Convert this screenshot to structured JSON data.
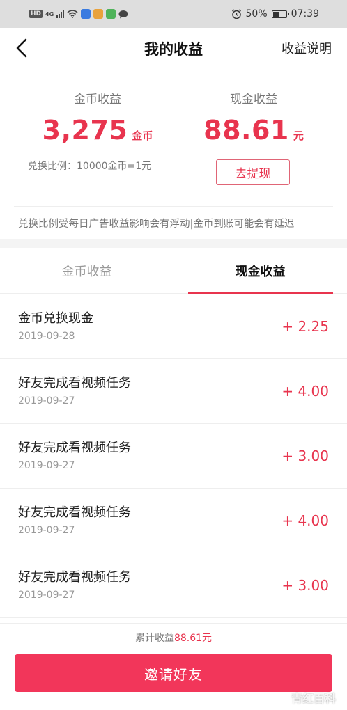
{
  "status_bar": {
    "network": "HD",
    "signal_label": "4G",
    "battery_percent": "50%",
    "time": "07:39",
    "battery_level": 0.5
  },
  "nav": {
    "title": "我的收益",
    "right_link": "收益说明"
  },
  "summary": {
    "coin_label": "金币收益",
    "coin_amount": "3,275",
    "coin_unit": "金币",
    "cash_label": "现金收益",
    "cash_amount": "88.61",
    "cash_unit": "元",
    "ratio_text": "兑换比例：10000金币=1元",
    "withdraw_label": "去提现",
    "notice": "兑换比例受每日广告收益影响会有浮动|金币到账可能会有延迟"
  },
  "tabs": [
    {
      "label": "金币收益",
      "active": false
    },
    {
      "label": "现金收益",
      "active": true
    }
  ],
  "records": [
    {
      "title": "金币兑换现金",
      "date": "2019-09-28",
      "amount": "+ 2.25"
    },
    {
      "title": "好友完成看视频任务",
      "date": "2019-09-27",
      "amount": "+ 4.00"
    },
    {
      "title": "好友完成看视频任务",
      "date": "2019-09-27",
      "amount": "+ 3.00"
    },
    {
      "title": "好友完成看视频任务",
      "date": "2019-09-27",
      "amount": "+ 4.00"
    },
    {
      "title": "好友完成看视频任务",
      "date": "2019-09-27",
      "amount": "+ 3.00"
    }
  ],
  "footer": {
    "total_label": "累计收益",
    "total_value": "88.61元",
    "invite_label": "邀请好友",
    "watermark": "青红百科"
  },
  "colors": {
    "accent": "#e8344e",
    "invite_button": "#f2365a",
    "status_bar_bg": "#dedede"
  }
}
